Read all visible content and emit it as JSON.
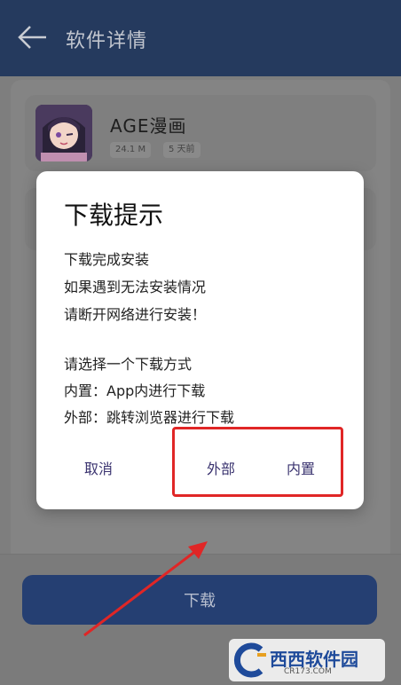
{
  "header": {
    "title": "软件详情"
  },
  "app": {
    "name": "AGE漫画",
    "size": "24.1 M",
    "age": "5 天前"
  },
  "dialog": {
    "title": "下载提示",
    "line1": "下载完成安装",
    "line2": "如果遇到无法安装情况",
    "line3": "请断开网络进行安装！",
    "line4": "请选择一个下载方式",
    "line5": "内置：App内进行下载",
    "line6": "外部：跳转浏览器进行下载",
    "cancel": "取消",
    "external": "外部",
    "internal": "内置"
  },
  "bottom": {
    "download": "下载"
  },
  "watermark": {
    "brand": "西西软件园",
    "site": "CR173.COM"
  },
  "colors": {
    "header": "#253a5e",
    "button": "#253f72",
    "highlight": "#e02626",
    "dialogAction": "#3b3470"
  }
}
